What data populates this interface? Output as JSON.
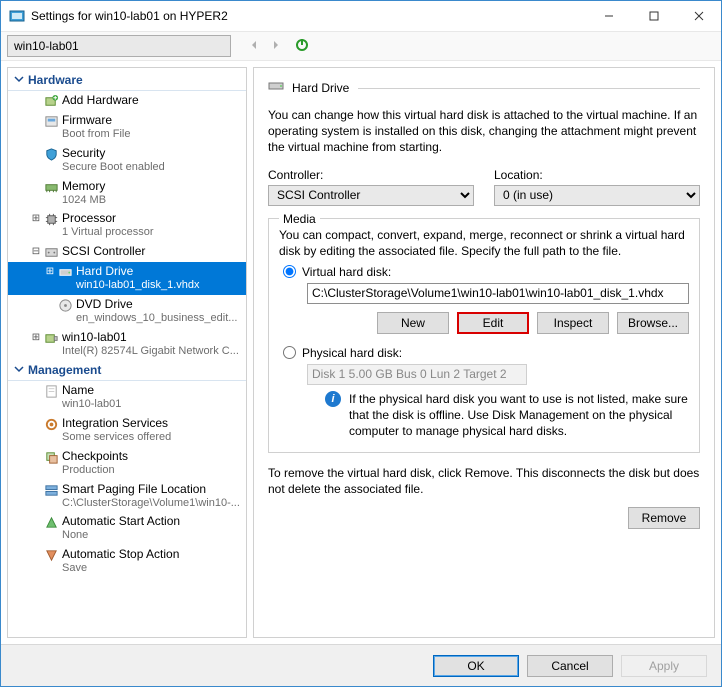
{
  "window": {
    "title": "Settings for win10-lab01 on HYPER2"
  },
  "toolbar": {
    "vm": "win10-lab01"
  },
  "sections": {
    "hardware": "Hardware",
    "management": "Management"
  },
  "tree": {
    "add_hardware": "Add Hardware",
    "firmware": {
      "label": "Firmware",
      "sub": "Boot from File"
    },
    "security": {
      "label": "Security",
      "sub": "Secure Boot enabled"
    },
    "memory": {
      "label": "Memory",
      "sub": "1024 MB"
    },
    "processor": {
      "label": "Processor",
      "sub": "1 Virtual processor"
    },
    "scsi": {
      "label": "SCSI Controller"
    },
    "hard_drive": {
      "label": "Hard Drive",
      "sub": "win10-lab01_disk_1.vhdx"
    },
    "dvd": {
      "label": "DVD Drive",
      "sub": "en_windows_10_business_edit..."
    },
    "nic": {
      "label": "win10-lab01",
      "sub": "Intel(R) 82574L Gigabit Network C..."
    },
    "name": {
      "label": "Name",
      "sub": "win10-lab01"
    },
    "integration": {
      "label": "Integration Services",
      "sub": "Some services offered"
    },
    "checkpoints": {
      "label": "Checkpoints",
      "sub": "Production"
    },
    "smartpaging": {
      "label": "Smart Paging File Location",
      "sub": "C:\\ClusterStorage\\Volume1\\win10-..."
    },
    "autostart": {
      "label": "Automatic Start Action",
      "sub": "None"
    },
    "autostop": {
      "label": "Automatic Stop Action",
      "sub": "Save"
    }
  },
  "pane": {
    "title": "Hard Drive",
    "intro": "You can change how this virtual hard disk is attached to the virtual machine. If an operating system is installed on this disk, changing the attachment might prevent the virtual machine from starting.",
    "controller_label": "Controller:",
    "location_label": "Location:",
    "controller_value": "SCSI Controller",
    "location_value": "0 (in use)",
    "media": {
      "legend": "Media",
      "desc": "You can compact, convert, expand, merge, reconnect or shrink a virtual hard disk by editing the associated file. Specify the full path to the file.",
      "vhd_label": "Virtual hard disk:",
      "vhd_path": "C:\\ClusterStorage\\Volume1\\win10-lab01\\win10-lab01_disk_1.vhdx",
      "btn_new": "New",
      "btn_edit": "Edit",
      "btn_inspect": "Inspect",
      "btn_browse": "Browse...",
      "phys_label": "Physical hard disk:",
      "phys_value": "Disk 1 5.00 GB Bus 0 Lun 2 Target 2",
      "phys_note": "If the physical hard disk you want to use is not listed, make sure that the disk is offline. Use Disk Management on the physical computer to manage physical hard disks."
    },
    "remove_note": "To remove the virtual hard disk, click Remove. This disconnects the disk but does not delete the associated file.",
    "btn_remove": "Remove"
  },
  "footer": {
    "ok": "OK",
    "cancel": "Cancel",
    "apply": "Apply"
  }
}
